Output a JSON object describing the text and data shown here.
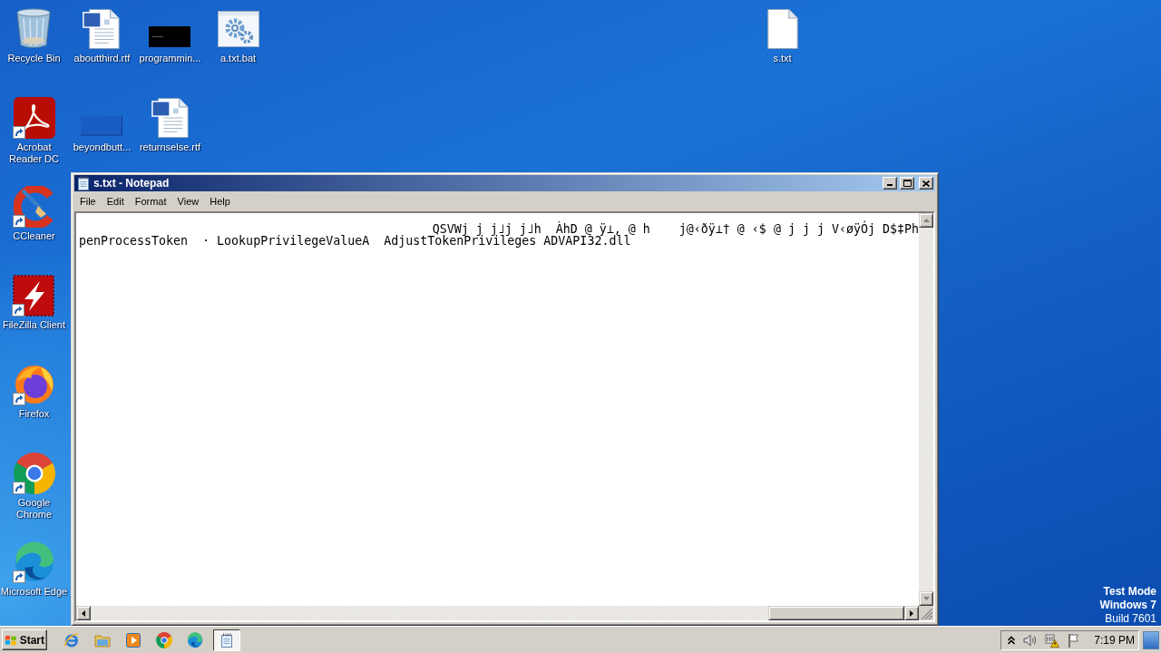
{
  "desktop": {
    "icons": [
      {
        "label": "Recycle Bin",
        "kind": "trash",
        "shortcut": false
      },
      {
        "label": "aboutthird.rtf",
        "kind": "document",
        "shortcut": false
      },
      {
        "label": "programmin...",
        "kind": "black-thumbnail",
        "shortcut": false
      },
      {
        "label": "a.txt.bat",
        "kind": "gears",
        "shortcut": false
      },
      {
        "label": "s.txt",
        "kind": "file",
        "shortcut": false
      },
      {
        "label": "Acrobat Reader DC",
        "kind": "swirl-tile",
        "shortcut": true
      },
      {
        "label": "beyondbutt...",
        "kind": "strip-thumbnail",
        "shortcut": false
      },
      {
        "label": "returnselse.rtf",
        "kind": "document",
        "shortcut": false
      },
      {
        "label": "CCleaner",
        "kind": "c-brush",
        "shortcut": true
      },
      {
        "label": "FileZilla Client",
        "kind": "bolt-tile",
        "shortcut": true
      },
      {
        "label": "Firefox",
        "kind": "fox-globe",
        "shortcut": true
      },
      {
        "label": "Google Chrome",
        "kind": "ring",
        "shortcut": true
      },
      {
        "label": "Microsoft Edge",
        "kind": "wave",
        "shortcut": true
      }
    ],
    "system_info": [
      "Test Mode",
      "Windows 7",
      "Build 7601"
    ]
  },
  "notepad": {
    "title": "s.txt - Notepad",
    "menu": [
      "File",
      "Edit",
      "Format",
      "View",
      "Help"
    ],
    "lines": [
      "QSVWj j j˩j j˩h  ÀhD @ ÿ⊥, @ h    j@‹ðÿ⊥† @ ‹$ @ j j j V‹øÿÓj D$‡Ph",
      "penProcessToken  · LookupPrivilegeValueA  AdjustTokenPrivileges ADVAPI32.dll"
    ]
  },
  "taskbar": {
    "start": "Start",
    "quick_launch": [
      {
        "kind": "e-logo"
      },
      {
        "kind": "folder"
      },
      {
        "kind": "play"
      },
      {
        "kind": "ring"
      },
      {
        "kind": "wave"
      }
    ],
    "tasks": [
      {
        "kind": "notepad",
        "selected": true
      }
    ],
    "clock": "7:19 PM"
  }
}
